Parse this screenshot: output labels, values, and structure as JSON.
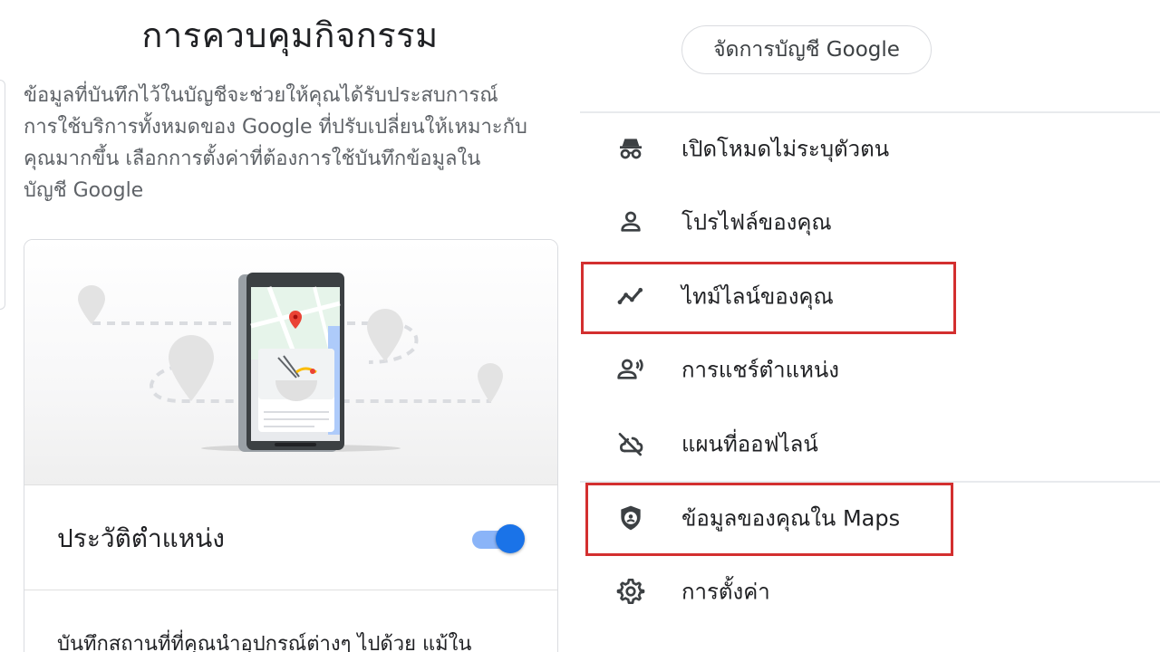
{
  "left_panel": {
    "title": "การควบคุมกิจกรรม",
    "intro_lines": [
      "ข้อมูลที่บันทึกไว้ในบัญชีจะช่วยให้คุณได้รับประสบการณ์",
      "การใช้บริการทั้งหมดของ Google ที่ปรับเปลี่ยนให้เหมาะกับ",
      "คุณมากขึ้น เลือกการตั้งค่าที่ต้องการใช้บันทึกข้อมูลใน",
      "บัญชี Google"
    ],
    "setting": {
      "label": "ประวัติตำแหน่ง",
      "enabled": true,
      "description": "บันทึกสถานที่ที่คุณนำอุปกรณ์ต่างๆ ไปด้วย แม้ใน"
    }
  },
  "right_panel": {
    "manage_account_label": "จัดการบัญชี Google",
    "menu_items": [
      {
        "label": "เปิดโหมดไม่ระบุตัวตน",
        "icon": "incognito-icon",
        "highlighted": false
      },
      {
        "label": "โปรไฟล์ของคุณ",
        "icon": "person-icon",
        "highlighted": false
      },
      {
        "label": "ไทม์ไลน์ของคุณ",
        "icon": "timeline-icon",
        "highlighted": true
      },
      {
        "label": "การแชร์ตำแหน่ง",
        "icon": "location-sharing-icon",
        "highlighted": false
      },
      {
        "label": "แผนที่ออฟไลน์",
        "icon": "offline-maps-icon",
        "highlighted": false
      },
      {
        "label": "ข้อมูลของคุณใน Maps",
        "icon": "data-shield-icon",
        "highlighted": true
      },
      {
        "label": "การตั้งค่า",
        "icon": "gear-icon",
        "highlighted": false
      }
    ]
  },
  "colors": {
    "accent": "#1a73e8",
    "toggle_track": "#8ab4f8",
    "highlight_box": "#d32f2f",
    "map_pin": "#ea4335"
  }
}
